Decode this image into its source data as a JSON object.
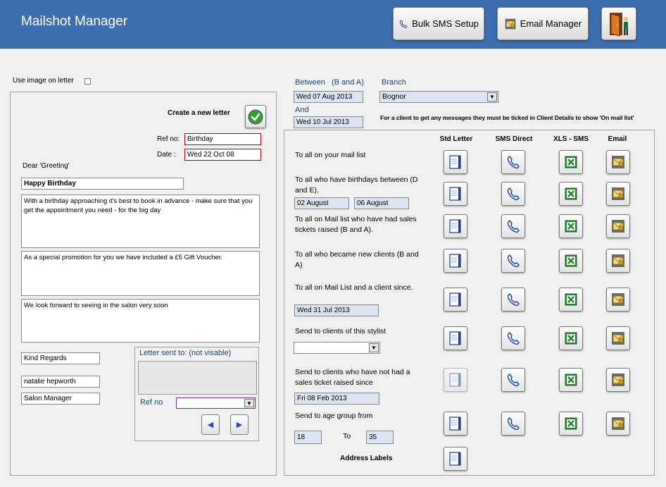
{
  "header": {
    "title": "Mailshot Manager",
    "bulk_sms_label": "Bulk SMS Setup",
    "email_manager_label": "Email Manager"
  },
  "letter": {
    "use_image_label": "Use image on letter",
    "create_label": "Create a new letter",
    "ref_label": "Ref no:",
    "ref_value": "Birthday",
    "date_label": "Date :",
    "date_value": "Wed 22 Oct 08",
    "greeting": "Dear 'Greeting'",
    "subject": "Happy Birthday",
    "paragraph1": "With a  birthday approaching it's best to book in advance - make sure that you get the appointment you need - for the big day",
    "paragraph2": "As a special promotion for you we have included a £5 Gift Voucher.",
    "paragraph3": "We look forward to seeing in the salon very soon",
    "signoff": "Kind Regards",
    "signer_name": "natalie hepworth",
    "signer_title": "Salon Manager"
  },
  "sent_panel": {
    "title": "Letter sent to: (not visable)",
    "ref_label": "Ref no",
    "ref_value": ""
  },
  "filters": {
    "between_label": "Between",
    "between_hint": "(B and A)",
    "date_from": "Wed 07 Aug 2013",
    "and_label": "And",
    "date_to": "Wed 10 Jul 2013",
    "branch_label": "Branch",
    "branch_value": "Bognor",
    "note": "For a client to get any messages they must be ticked in Client Details to show 'On mail list'"
  },
  "columns": [
    "Std Letter",
    "SMS Direct",
    "XLS - SMS",
    "Email"
  ],
  "rows": {
    "r1": {
      "label": "To all on your mail list"
    },
    "r2": {
      "label": "To all who have birthdays between (D and E).",
      "from": "02 August",
      "to": "06  August"
    },
    "r3": {
      "label": "To all on Mail list who have had sales  tickets raised (B and A)."
    },
    "r4": {
      "label": "To all who became new clients (B and A)"
    },
    "r5": {
      "label": "To all on Mail List and a client since.",
      "date": "Wed 31 Jul 2013"
    },
    "r6": {
      "label": "Send to clients of this stylist",
      "stylist": ""
    },
    "r7": {
      "label": "Send to clients who have not had a sales ticket raised since",
      "date": "Fri 08 Feb 2013"
    },
    "r8": {
      "label": "Send to age group from",
      "age_from": "18",
      "to_label": "To",
      "age_to": "35"
    },
    "r9": {
      "label": "Address Labels"
    }
  },
  "icons": {
    "letter": "document-icon",
    "sms": "phone-icon",
    "xls": "excel-icon",
    "email": "email-icon",
    "exit": "exit-door-icon",
    "confirm": "check-icon"
  }
}
